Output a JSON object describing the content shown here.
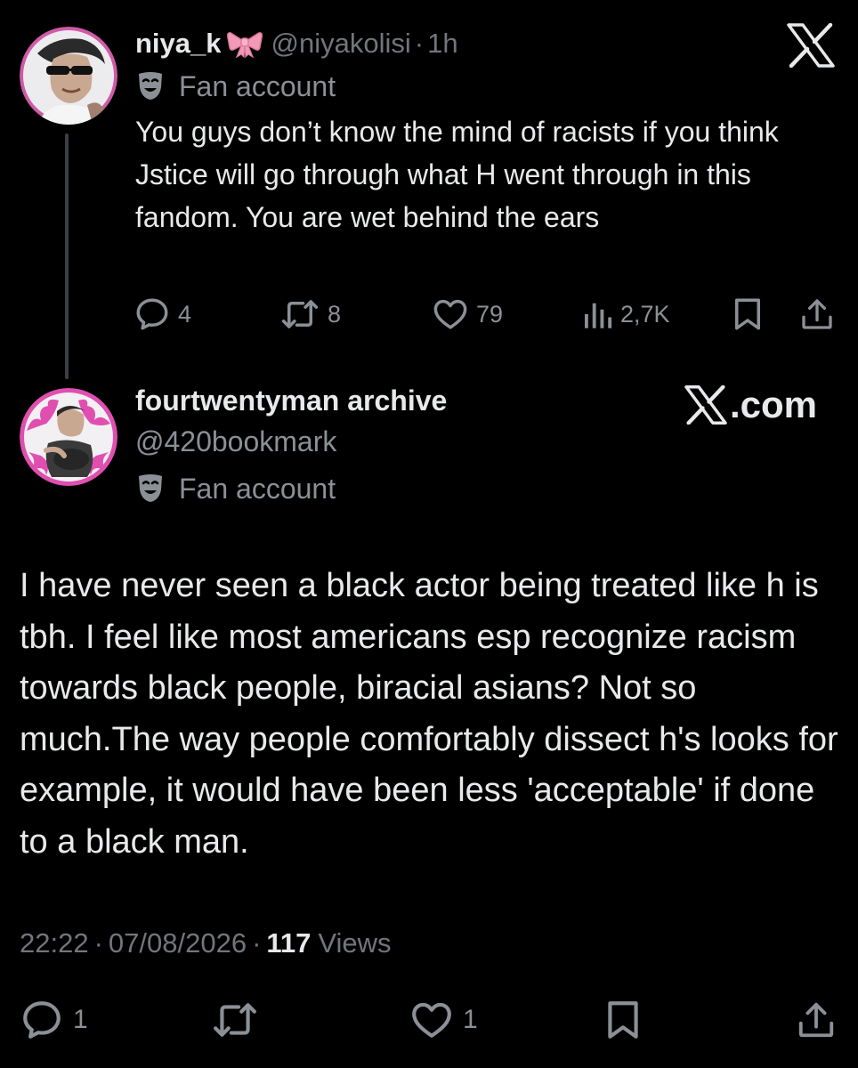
{
  "tweet1": {
    "display_name": "niya_k",
    "handle": "@niyakolisi",
    "separator": "·",
    "time": "1h",
    "label": "Fan account",
    "text": "You guys don’t know the mind of racists if you think Jstice will go through what H went through in this fandom. You are wet behind the ears",
    "replies": "4",
    "reposts": "8",
    "likes": "79",
    "views": "2,7K"
  },
  "tweet2": {
    "display_name": "fourtwentyman archive",
    "handle": "@420bookmark",
    "label": "Fan account",
    "text": "I have never seen a black actor being treated like h is tbh.  I feel like most americans esp recognize racism towards black people, biracial asians? Not so much.The way people comfortably dissect h's looks for example, it would have been less 'acceptable' if done to a black man.",
    "time": "22:22",
    "separator": "·",
    "date": "07/08/2026",
    "views_count": "117",
    "views_label": "Views",
    "replies": "1",
    "likes": "1"
  },
  "watermark": {
    "suffix": ".com"
  },
  "icons": {
    "x_logo": "x-logo-icon",
    "bow": "ribbon-bow-icon",
    "fan_badge": "theater-mask-icon",
    "reply": "speech-bubble-icon",
    "repost": "repost-icon",
    "like": "heart-icon",
    "views": "bar-chart-icon",
    "bookmark": "bookmark-icon",
    "share": "share-upload-icon"
  },
  "colors": {
    "background": "#000000",
    "text_primary": "#e7e9ea",
    "text_secondary": "#71767b",
    "avatar_ring": "#e04fb0",
    "bow_pink": "#f29ab8"
  }
}
